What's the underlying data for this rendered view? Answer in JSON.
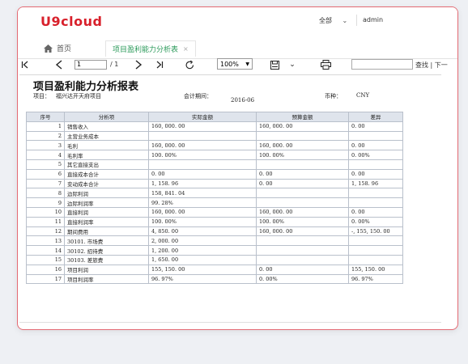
{
  "brand": {
    "logo": "U9cloud"
  },
  "header": {
    "org": "全部",
    "user": "admin"
  },
  "tabs": {
    "home": "首页",
    "active": "项目盈利能力分析表"
  },
  "toolbar": {
    "page_value": "1",
    "page_total": "/ 1",
    "zoom": "100%",
    "search_label": "查找 | 下一"
  },
  "report": {
    "title": "项目盈利能力分析报表",
    "project_label": "项目：",
    "project_value": "福兴达开天府项目",
    "period_label": "会计期间：",
    "period_value": "2016-06",
    "currency_label": "币种：",
    "currency_value": "CNY",
    "columns": [
      "序号",
      "分析项",
      "实际金额",
      "预算金额",
      "差异"
    ],
    "rows": [
      [
        "1",
        "销售收入",
        "160, 000. 00",
        "160, 000. 00",
        "0. 00"
      ],
      [
        "2",
        "主营业务成本",
        "",
        "",
        ""
      ],
      [
        "3",
        "毛利",
        "160, 000. 00",
        "160, 000. 00",
        "0. 00"
      ],
      [
        "4",
        "毛利率",
        "100. 00%",
        "100. 00%",
        "0. 00%"
      ],
      [
        "5",
        "其它直接支出",
        "",
        "",
        ""
      ],
      [
        "6",
        "直接成本合计",
        "0. 00",
        "0. 00",
        "0. 00"
      ],
      [
        "7",
        "变动成本合计",
        "1, 158. 96",
        "0. 00",
        "1, 158. 96"
      ],
      [
        "8",
        "边际利润",
        "158, 841. 04",
        "",
        ""
      ],
      [
        "9",
        "边际利润率",
        "99. 28%",
        "",
        ""
      ],
      [
        "10",
        "直接利润",
        "160, 000. 00",
        "160, 000. 00",
        "0. 00"
      ],
      [
        "11",
        "直接利润率",
        "100. 00%",
        "100. 00%",
        "0. 00%"
      ],
      [
        "12",
        "期间费用",
        "4, 850. 00",
        "160, 000. 00",
        "-, 155, 150. 00"
      ],
      [
        "13",
        "30101. 市场费",
        "2, 000. 00",
        "",
        ""
      ],
      [
        "14",
        "30102. 招待费",
        "1, 200. 00",
        "",
        ""
      ],
      [
        "15",
        "30103. 差旅费",
        "1, 650. 00",
        "",
        ""
      ],
      [
        "16",
        "项目利润",
        "155, 150. 00",
        "0. 00",
        "155, 150. 00"
      ],
      [
        "17",
        "项目利润率",
        "96. 97%",
        "0. 00%",
        "96. 97%"
      ]
    ]
  },
  "colors": {
    "brand_red": "#d8202b",
    "active_tab_green": "#2b9a5a",
    "header_bg": "#dfe4ec"
  }
}
